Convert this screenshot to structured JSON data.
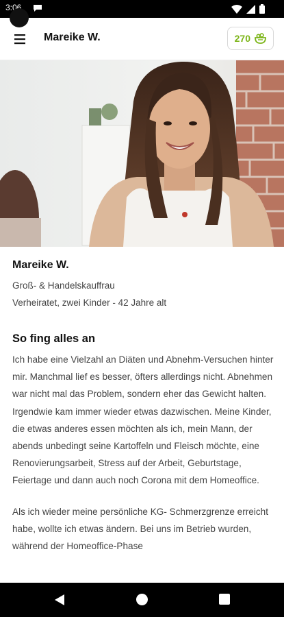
{
  "status_bar": {
    "time": "3:06",
    "icons": [
      "message-icon",
      "wifi-icon",
      "signal-icon",
      "battery-icon"
    ]
  },
  "app_bar": {
    "title": "Mareike W.",
    "points": "270",
    "menu_icon": "menu-icon",
    "points_icon": "salad-bowl-icon",
    "accent_color": "#7cb518"
  },
  "hero": {
    "image": "portrait-photo"
  },
  "profile": {
    "name": "Mareike W.",
    "occupation": "Groß- & Handelskauffrau",
    "details": "Verheiratet, zwei Kinder - 42 Jahre alt"
  },
  "story": {
    "title": "So fing alles an",
    "paragraphs": [
      "Ich habe eine Vielzahl an Diäten und Abnehm-Versuchen hinter mir. Manchmal lief es besser, öfters allerdings nicht. Abnehmen war nicht mal das Problem, sondern eher das Gewicht halten. Irgendwie kam immer wieder etwas dazwischen. Meine Kinder, die etwas anderes essen möchten als ich, mein Mann, der abends unbedingt seine Kartoffeln und Fleisch möchte, eine Renovierungsarbeit, Stress auf der Arbeit, Geburtstage, Feiertage und dann auch noch Corona mit dem Homeoffice.",
      "Als ich wieder meine persönliche KG- Schmerzgrenze erreicht habe, wollte ich etwas ändern. Bei uns im Betrieb wurden, während der Homeoffice-Phase"
    ]
  },
  "nav_bar": {
    "icons": [
      "back-icon",
      "home-icon",
      "recents-icon"
    ]
  }
}
